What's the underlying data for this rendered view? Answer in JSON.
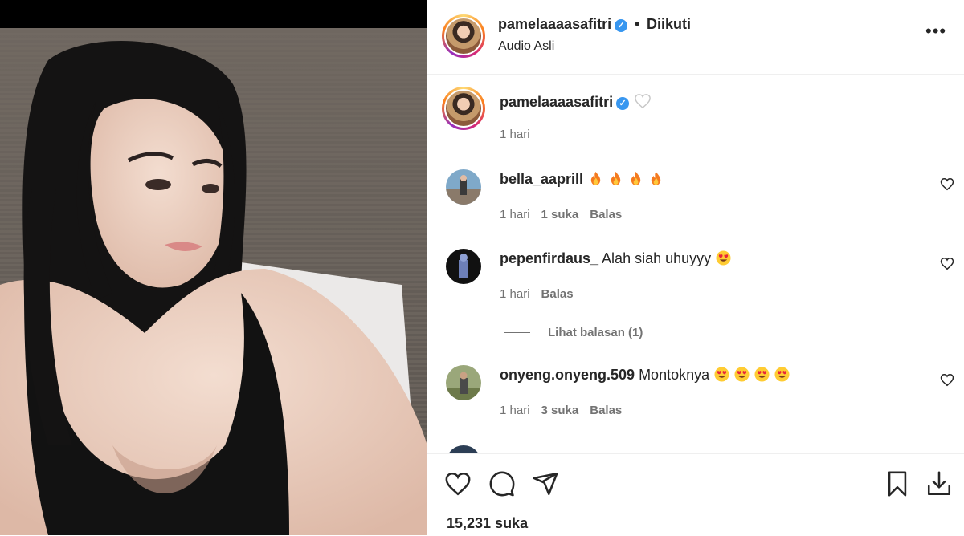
{
  "header": {
    "username": "pamelaaaasafitri",
    "follow_status": "Diikuti",
    "separator": "•",
    "audio": "Audio Asli",
    "more": "•••"
  },
  "caption": {
    "username": "pamelaaaasafitri",
    "time": "1 hari"
  },
  "comments": [
    {
      "username": "bella_aaprill",
      "text": "",
      "emoji": "fire",
      "emoji_count": 4,
      "time": "1 hari",
      "likes": "1 suka",
      "reply": "Balas"
    },
    {
      "username": "pepenfirdaus_",
      "text": "Alah siah uhuyyy",
      "emoji": "heart-eyes",
      "emoji_count": 1,
      "time": "1 hari",
      "likes": "",
      "reply": "Balas",
      "view_replies": "Lihat balasan (1)"
    },
    {
      "username": "onyeng.onyeng.509",
      "text": "Montoknya",
      "emoji": "heart-eyes",
      "emoji_count": 4,
      "time": "1 hari",
      "likes": "3 suka",
      "reply": "Balas"
    }
  ],
  "footer": {
    "likes": "15,231 suka"
  },
  "colors": {
    "verified": "#3897f0",
    "meta": "#737373",
    "text": "#262626"
  },
  "icons": [
    "heart-icon",
    "comment-icon",
    "share-icon",
    "bookmark-icon",
    "download-icon",
    "verified-icon",
    "more-icon"
  ]
}
